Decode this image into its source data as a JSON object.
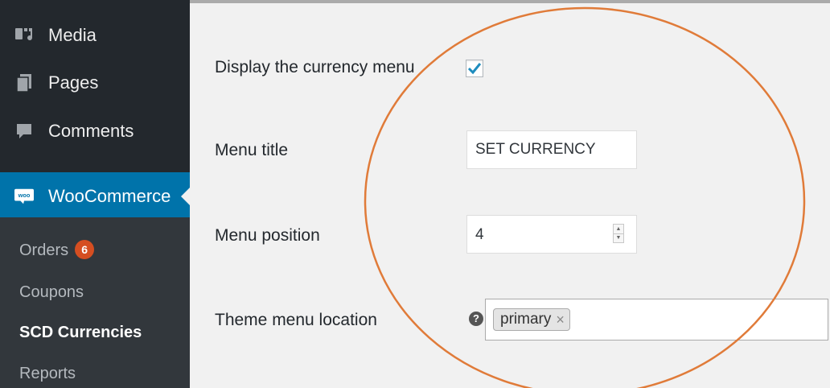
{
  "sidebar": {
    "items": [
      {
        "label": "Media",
        "icon": "media-icon"
      },
      {
        "label": "Pages",
        "icon": "pages-icon"
      },
      {
        "label": "Comments",
        "icon": "comments-icon"
      },
      {
        "label": "WooCommerce",
        "icon": "woo-icon",
        "icon_text": "woo"
      }
    ],
    "submenu": [
      {
        "label": "Orders",
        "badge": "6"
      },
      {
        "label": "Coupons"
      },
      {
        "label": "SCD Currencies"
      },
      {
        "label": "Reports"
      }
    ]
  },
  "settings": {
    "display_menu": {
      "label": "Display the currency menu",
      "checked": true
    },
    "menu_title": {
      "label": "Menu title",
      "value": "SET CURRENCY"
    },
    "menu_position": {
      "label": "Menu position",
      "value": "4"
    },
    "theme_location": {
      "label": "Theme menu location",
      "help_icon": "?",
      "selected": "primary",
      "remove_glyph": "×"
    }
  },
  "colors": {
    "sidebar_bg": "#23282d",
    "submenu_bg": "#32373c",
    "active_bg": "#0073aa",
    "badge": "#d54e21",
    "checkmark": "#1e8cbe",
    "annotation_ellipse": "#e07b39"
  }
}
